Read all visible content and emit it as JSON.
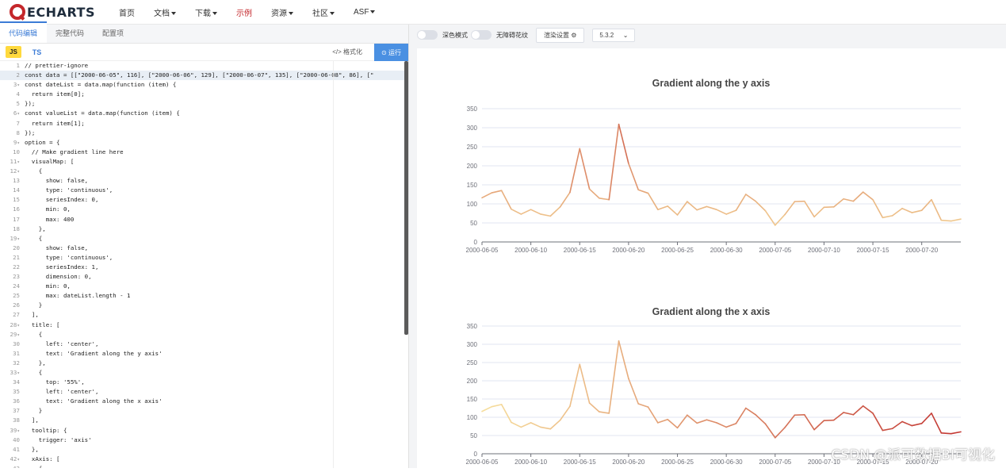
{
  "nav": {
    "logo_text": "ECHARTS",
    "items": [
      {
        "label": "首页",
        "caret": false,
        "active": false
      },
      {
        "label": "文档",
        "caret": true,
        "active": false
      },
      {
        "label": "下载",
        "caret": true,
        "active": false
      },
      {
        "label": "示例",
        "caret": false,
        "active": true
      },
      {
        "label": "资源",
        "caret": true,
        "active": false
      },
      {
        "label": "社区",
        "caret": true,
        "active": false
      },
      {
        "label": "ASF",
        "caret": true,
        "active": false
      }
    ]
  },
  "editor": {
    "tabs": [
      {
        "label": "代码编辑",
        "active": true
      },
      {
        "label": "完整代码",
        "active": false
      },
      {
        "label": "配置项",
        "active": false
      }
    ],
    "lang_js": "JS",
    "lang_ts": "TS",
    "format_label": "格式化",
    "run_label": "运行",
    "lines": [
      {
        "n": "1",
        "fold": false,
        "hl": false,
        "text": "// prettier-ignore"
      },
      {
        "n": "2",
        "fold": false,
        "hl": true,
        "text": "const data = [[\"2000-06-05\", 116], [\"2000-06-06\", 129], [\"2000-06-07\", 135], [\"2000-06-08\", 86], [\""
      },
      {
        "n": "3",
        "fold": true,
        "hl": false,
        "text": "const dateList = data.map(function (item) {"
      },
      {
        "n": "4",
        "fold": false,
        "hl": false,
        "text": "  return item[0];"
      },
      {
        "n": "5",
        "fold": false,
        "hl": false,
        "text": "});"
      },
      {
        "n": "6",
        "fold": true,
        "hl": false,
        "text": "const valueList = data.map(function (item) {"
      },
      {
        "n": "7",
        "fold": false,
        "hl": false,
        "text": "  return item[1];"
      },
      {
        "n": "8",
        "fold": false,
        "hl": false,
        "text": "});"
      },
      {
        "n": "9",
        "fold": true,
        "hl": false,
        "text": "option = {"
      },
      {
        "n": "10",
        "fold": false,
        "hl": false,
        "text": "  // Make gradient line here"
      },
      {
        "n": "11",
        "fold": true,
        "hl": false,
        "text": "  visualMap: ["
      },
      {
        "n": "12",
        "fold": true,
        "hl": false,
        "text": "    {"
      },
      {
        "n": "13",
        "fold": false,
        "hl": false,
        "text": "      show: false,"
      },
      {
        "n": "14",
        "fold": false,
        "hl": false,
        "text": "      type: 'continuous',"
      },
      {
        "n": "15",
        "fold": false,
        "hl": false,
        "text": "      seriesIndex: 0,"
      },
      {
        "n": "16",
        "fold": false,
        "hl": false,
        "text": "      min: 0,"
      },
      {
        "n": "17",
        "fold": false,
        "hl": false,
        "text": "      max: 400"
      },
      {
        "n": "18",
        "fold": false,
        "hl": false,
        "text": "    },"
      },
      {
        "n": "19",
        "fold": true,
        "hl": false,
        "text": "    {"
      },
      {
        "n": "20",
        "fold": false,
        "hl": false,
        "text": "      show: false,"
      },
      {
        "n": "21",
        "fold": false,
        "hl": false,
        "text": "      type: 'continuous',"
      },
      {
        "n": "22",
        "fold": false,
        "hl": false,
        "text": "      seriesIndex: 1,"
      },
      {
        "n": "23",
        "fold": false,
        "hl": false,
        "text": "      dimension: 0,"
      },
      {
        "n": "24",
        "fold": false,
        "hl": false,
        "text": "      min: 0,"
      },
      {
        "n": "25",
        "fold": false,
        "hl": false,
        "text": "      max: dateList.length - 1"
      },
      {
        "n": "26",
        "fold": false,
        "hl": false,
        "text": "    }"
      },
      {
        "n": "27",
        "fold": false,
        "hl": false,
        "text": "  ],"
      },
      {
        "n": "28",
        "fold": true,
        "hl": false,
        "text": "  title: ["
      },
      {
        "n": "29",
        "fold": true,
        "hl": false,
        "text": "    {"
      },
      {
        "n": "30",
        "fold": false,
        "hl": false,
        "text": "      left: 'center',"
      },
      {
        "n": "31",
        "fold": false,
        "hl": false,
        "text": "      text: 'Gradient along the y axis'"
      },
      {
        "n": "32",
        "fold": false,
        "hl": false,
        "text": "    },"
      },
      {
        "n": "33",
        "fold": true,
        "hl": false,
        "text": "    {"
      },
      {
        "n": "34",
        "fold": false,
        "hl": false,
        "text": "      top: '55%',"
      },
      {
        "n": "35",
        "fold": false,
        "hl": false,
        "text": "      left: 'center',"
      },
      {
        "n": "36",
        "fold": false,
        "hl": false,
        "text": "      text: 'Gradient along the x axis'"
      },
      {
        "n": "37",
        "fold": false,
        "hl": false,
        "text": "    }"
      },
      {
        "n": "38",
        "fold": false,
        "hl": false,
        "text": "  ],"
      },
      {
        "n": "39",
        "fold": true,
        "hl": false,
        "text": "  tooltip: {"
      },
      {
        "n": "40",
        "fold": false,
        "hl": false,
        "text": "    trigger: 'axis'"
      },
      {
        "n": "41",
        "fold": false,
        "hl": false,
        "text": "  },"
      },
      {
        "n": "42",
        "fold": true,
        "hl": false,
        "text": "  xAxis: ["
      },
      {
        "n": "43",
        "fold": false,
        "hl": false,
        "text": "    {"
      }
    ]
  },
  "preview": {
    "dark_mode_label": "深色模式",
    "no_decal_label": "无障碍花纹",
    "render_settings_label": "渲染设置",
    "version": "5.3.2"
  },
  "chart_data": [
    {
      "type": "line",
      "title": "Gradient along the y axis",
      "gradient": "y",
      "ylim": [
        0,
        350
      ],
      "yticks": [
        0,
        50,
        100,
        150,
        200,
        250,
        300,
        350
      ],
      "x_tick_labels": [
        "2000-06-05",
        "2000-06-10",
        "2000-06-15",
        "2000-06-20",
        "2000-06-25",
        "2000-06-30",
        "2000-07-05",
        "2000-07-10",
        "2000-07-15",
        "2000-07-20"
      ],
      "x_start": "2000-06-05",
      "values": [
        116,
        129,
        135,
        86,
        73,
        85,
        73,
        68,
        92,
        130,
        245,
        139,
        115,
        111,
        309,
        206,
        137,
        128,
        85,
        94,
        71,
        106,
        84,
        93,
        85,
        73,
        83,
        125,
        107,
        82,
        44,
        72,
        106,
        107,
        66,
        91,
        92,
        113,
        107,
        131,
        111,
        64,
        69,
        88,
        77,
        83,
        111,
        57,
        55,
        60
      ],
      "colors": [
        "#f7df9d",
        "#c23531"
      ]
    },
    {
      "type": "line",
      "title": "Gradient along the x axis",
      "gradient": "x",
      "ylim": [
        0,
        350
      ],
      "yticks": [
        0,
        50,
        100,
        150,
        200,
        250,
        300,
        350
      ],
      "x_tick_labels": [
        "2000-06-05",
        "2000-06-10",
        "2000-06-15",
        "2000-06-20",
        "2000-06-25",
        "2000-06-30",
        "2000-07-05",
        "2000-07-10",
        "2000-07-15",
        "2000-07-20"
      ],
      "x_start": "2000-06-05",
      "values": [
        116,
        129,
        135,
        86,
        73,
        85,
        73,
        68,
        92,
        130,
        245,
        139,
        115,
        111,
        309,
        206,
        137,
        128,
        85,
        94,
        71,
        106,
        84,
        93,
        85,
        73,
        83,
        125,
        107,
        82,
        44,
        72,
        106,
        107,
        66,
        91,
        92,
        113,
        107,
        131,
        111,
        64,
        69,
        88,
        77,
        83,
        111,
        57,
        55,
        60
      ],
      "colors": [
        "#f7df9d",
        "#c23531"
      ]
    }
  ],
  "watermark": "CSDN @派可数据BI可视化"
}
